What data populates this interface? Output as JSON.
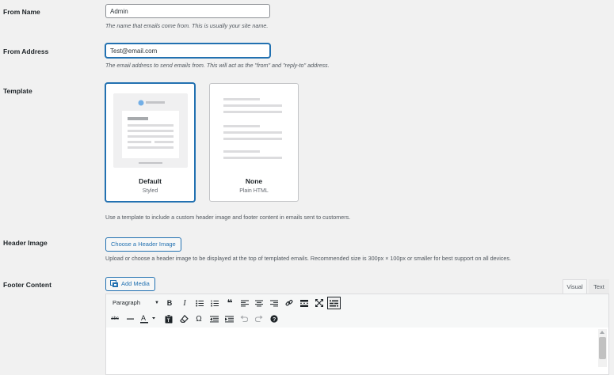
{
  "from_name": {
    "label": "From Name",
    "value": "Admin",
    "description": "The name that emails come from. This is usually your site name."
  },
  "from_address": {
    "label": "From Address",
    "value": "Test@email.com",
    "description": "The email address to send emails from. This will act as the \"from\" and \"reply-to\" address."
  },
  "template": {
    "label": "Template",
    "options": [
      {
        "title": "Default",
        "subtitle": "Styled",
        "selected": true
      },
      {
        "title": "None",
        "subtitle": "Plain HTML",
        "selected": false
      }
    ],
    "description": "Use a template to include a custom header image and footer content in emails sent to customers."
  },
  "header_image": {
    "label": "Header Image",
    "button": "Choose a Header Image",
    "description": "Upload or choose a header image to be displayed at the top of templated emails. Recommended size is 300px × 100px or smaller for best support on all devices."
  },
  "footer_content": {
    "label": "Footer Content",
    "add_media": "Add Media",
    "tabs": {
      "visual": "Visual",
      "text": "Text"
    },
    "format_select": "Paragraph",
    "toolbar_icons": [
      "bold-icon",
      "italic-icon",
      "bullet-list-icon",
      "numbered-list-icon",
      "blockquote-icon",
      "align-left-icon",
      "align-center-icon",
      "align-right-icon",
      "link-icon",
      "read-more-icon",
      "fullscreen-icon",
      "toolbar-toggle-icon",
      "strikethrough-icon",
      "horizontal-line-icon",
      "text-color-icon",
      "paste-text-icon",
      "clear-formatting-icon",
      "special-character-icon",
      "outdent-icon",
      "indent-icon",
      "undo-icon",
      "redo-icon",
      "help-icon"
    ]
  },
  "colors": {
    "accent": "#2271b1",
    "background": "#f1f1f1",
    "text": "#1d2327"
  }
}
